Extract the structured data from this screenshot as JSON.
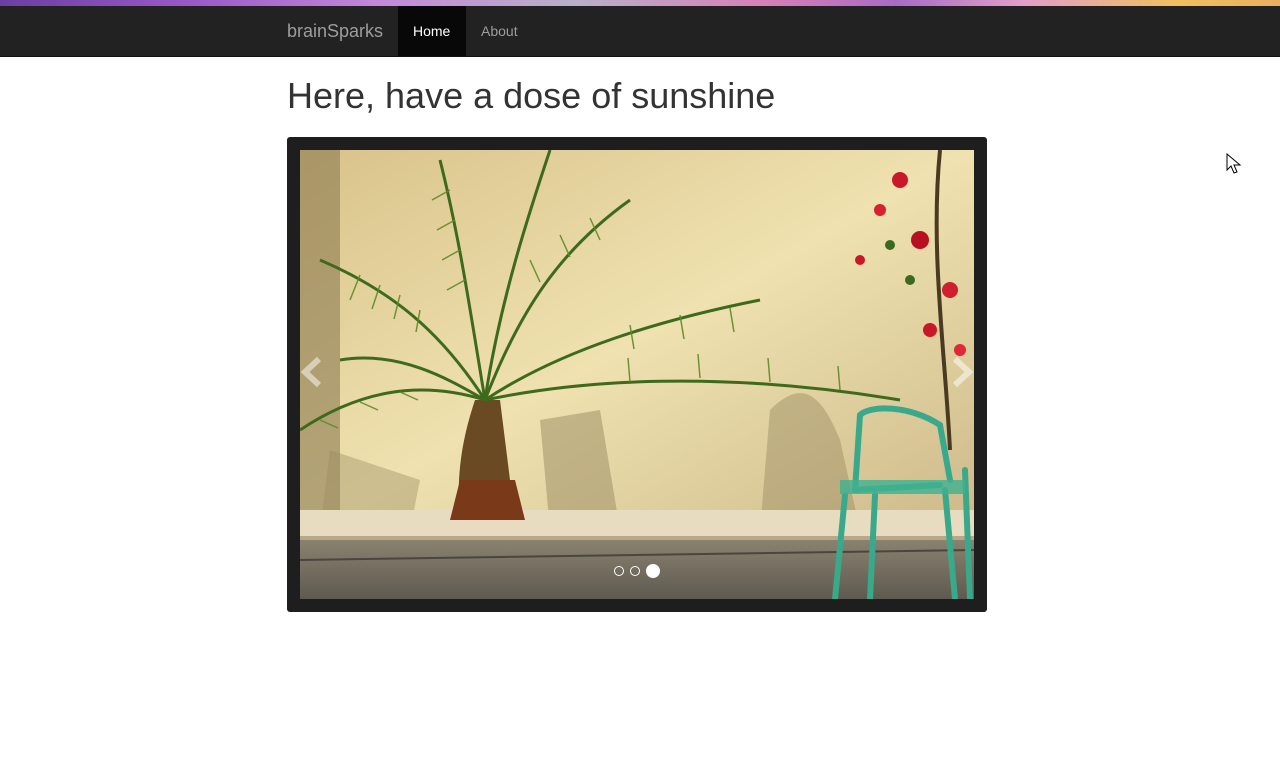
{
  "navbar": {
    "brand": "brainSparks",
    "items": [
      {
        "label": "Home",
        "active": true
      },
      {
        "label": "About",
        "active": false
      }
    ]
  },
  "main": {
    "title": "Here, have a dose of sunshine"
  },
  "carousel": {
    "slide_count": 3,
    "active_index": 2
  },
  "colors": {
    "navbar_bg": "#222222",
    "active_nav_bg": "#080808",
    "carousel_frame": "#1e1e1e"
  }
}
